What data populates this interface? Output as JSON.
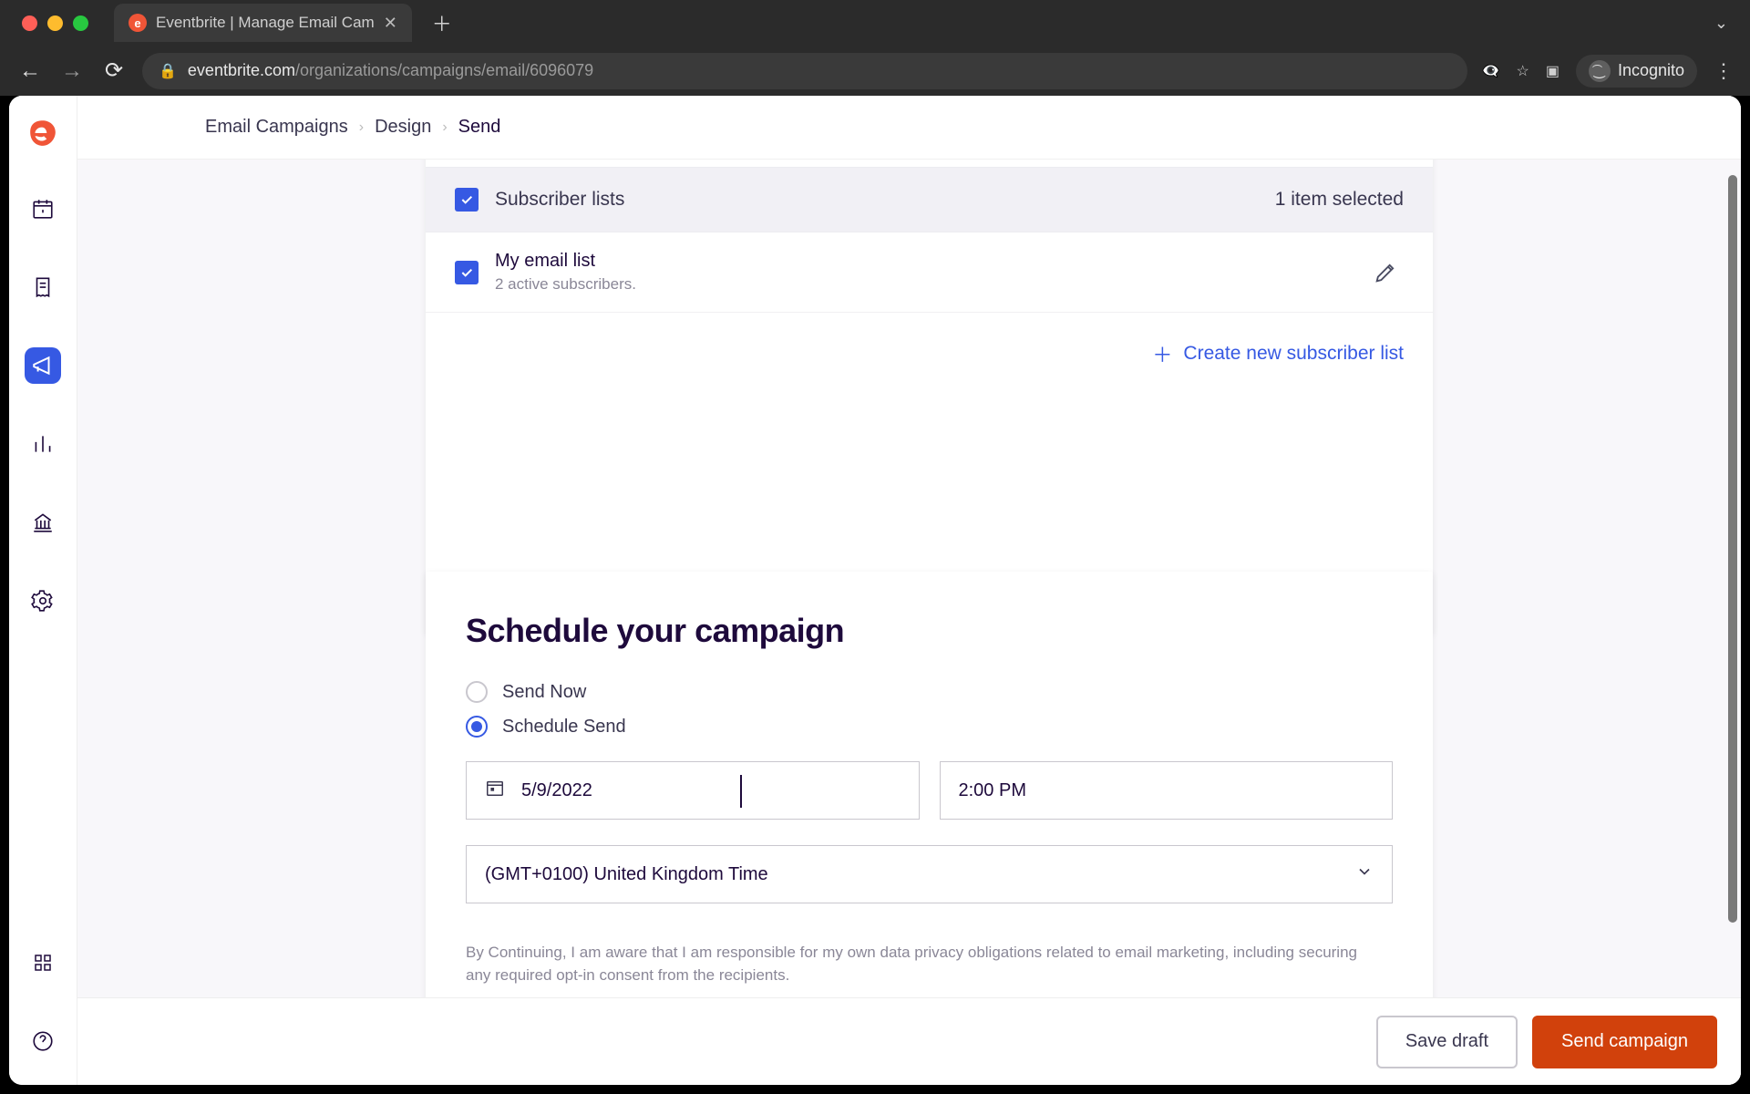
{
  "browser": {
    "tab_title": "Eventbrite | Manage Email Cam",
    "url_host": "eventbrite.com",
    "url_path": "/organizations/campaigns/email/6096079",
    "incognito_label": "Incognito"
  },
  "breadcrumbs": {
    "item1": "Email Campaigns",
    "item2": "Design",
    "item3": "Send"
  },
  "subscribers": {
    "header_label": "Subscriber lists",
    "header_count": "1 item selected",
    "row_title": "My email list",
    "row_subtitle": "2 active subscribers.",
    "create_label": "Create new subscriber list"
  },
  "schedule": {
    "heading": "Schedule your campaign",
    "radio_now": "Send Now",
    "radio_schedule": "Schedule Send",
    "date_value": "5/9/2022",
    "time_value": "2:00 PM",
    "tz_value": "(GMT+0100) United Kingdom Time",
    "legal": "By Continuing, I am aware that I am responsible for my own data privacy obligations related to email marketing, including securing any required opt-in consent from the recipients."
  },
  "footer": {
    "save_draft": "Save draft",
    "send_campaign": "Send campaign"
  }
}
